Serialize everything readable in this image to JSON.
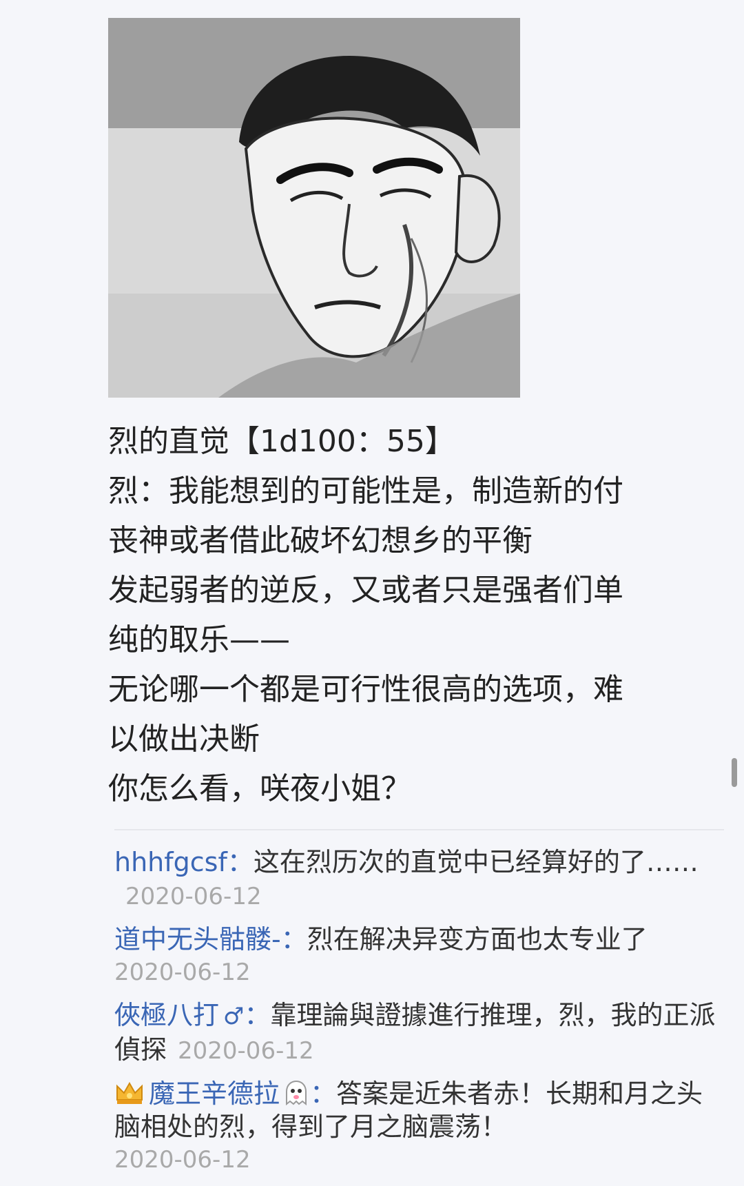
{
  "post": {
    "image": {
      "icon": "manga-face-illustration"
    },
    "lines": [
      "烈的直觉【1d100：55】",
      "烈：我能想到的可能性是，制造新的付",
      "丧神或者借此破坏幻想乡的平衡",
      "发起弱者的逆反，又或者只是强者们单",
      "纯的取乐——",
      "无论哪一个都是可行性很高的选项，难",
      "以做出决断",
      "你怎么看，咲夜小姐？"
    ]
  },
  "comments": [
    {
      "author": "hhhfgcsf",
      "separator": "：",
      "text": "这在烈历次的直觉中已经算好的了……",
      "date": "2020-06-12"
    },
    {
      "author": "道中无头骷髅-",
      "separator": "：",
      "text": "烈在解决异变方面也太专业了",
      "date": "2020-06-12"
    },
    {
      "author": "俠極八打",
      "author_badge": "♂",
      "separator": "：",
      "text": "靠理論與證據進行推理，烈，我的正派偵探",
      "date": "2020-06-12"
    },
    {
      "author": "魔王辛德拉",
      "author_prefix_icon": "crown-badge-icon",
      "author_suffix_icon": "ghost-emoji-icon",
      "separator": "：",
      "text": "答案是近朱者赤！长期和月之头脑相处的烈，得到了月之脑震荡！",
      "date": "2020-06-12"
    }
  ],
  "colors": {
    "author": "#3a66b5",
    "date": "#a9a9a9",
    "background": "#f5f6fa"
  }
}
